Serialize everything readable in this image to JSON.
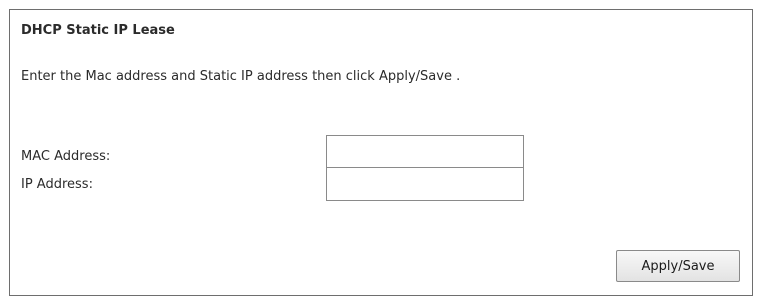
{
  "section": {
    "title": "DHCP Static IP Lease",
    "instruction": "Enter the Mac address and Static IP address then click Apply/Save ."
  },
  "form": {
    "mac_label": "MAC Address:",
    "mac_value": "",
    "ip_label": "IP Address:",
    "ip_value": ""
  },
  "actions": {
    "apply_save_label": "Apply/Save"
  }
}
